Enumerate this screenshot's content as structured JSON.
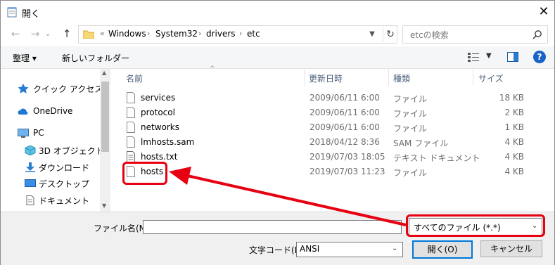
{
  "window": {
    "title": "開く",
    "close_glyph": "✕"
  },
  "nav": {
    "back_glyph": "←",
    "forward_glyph": "→",
    "dropdown_glyph": "⌄",
    "up_glyph": "↑"
  },
  "address": {
    "overflow": "«",
    "crumbs": [
      "Windows",
      "System32",
      "drivers",
      "etc"
    ],
    "separator": "›",
    "refresh_glyph": "↻"
  },
  "search": {
    "placeholder": "etcの検索",
    "icon": "search-icon"
  },
  "toolbar": {
    "organize_label": "整理 ▾",
    "new_folder_label": "新しいフォルダー",
    "help_glyph": "?"
  },
  "sidebar": {
    "items": [
      {
        "label": "クイック アクセス",
        "icon": "quick-access-icon"
      },
      {
        "label": "OneDrive",
        "icon": "onedrive-icon"
      },
      {
        "label": "PC",
        "icon": "pc-icon"
      },
      {
        "label": "3D オブジェクト",
        "icon": "3d-objects-icon"
      },
      {
        "label": "ダウンロード",
        "icon": "downloads-icon"
      },
      {
        "label": "デスクトップ",
        "icon": "desktop-icon"
      },
      {
        "label": "ドキュメント",
        "icon": "documents-icon"
      }
    ]
  },
  "columns": {
    "name": "名前",
    "modified": "更新日時",
    "type": "種類",
    "size": "サイズ"
  },
  "files": [
    {
      "name": "services",
      "modified": "2009/06/11 6:00",
      "type": "ファイル",
      "size": "18 KB"
    },
    {
      "name": "protocol",
      "modified": "2009/06/11 6:00",
      "type": "ファイル",
      "size": "2 KB"
    },
    {
      "name": "networks",
      "modified": "2009/06/11 6:00",
      "type": "ファイル",
      "size": "1 KB"
    },
    {
      "name": "lmhosts.sam",
      "modified": "2018/04/12 8:36",
      "type": "SAM ファイル",
      "size": "4 KB"
    },
    {
      "name": "hosts.txt",
      "modified": "2019/07/03 18:05",
      "type": "テキスト ドキュメント",
      "size": "4 KB"
    },
    {
      "name": "hosts",
      "modified": "2019/07/03 11:23",
      "type": "ファイル",
      "size": "4 KB"
    }
  ],
  "footer": {
    "filename_label": "ファイル名(N):",
    "filename_value": "",
    "filetype_value": "すべてのファイル (*.*)",
    "encoding_label": "文字コード(E):",
    "encoding_value": "ANSI",
    "open_label": "開く(O)",
    "cancel_label": "キャンセル"
  },
  "colors": {
    "annotation": "#e60012",
    "accent": "#0078d7"
  }
}
